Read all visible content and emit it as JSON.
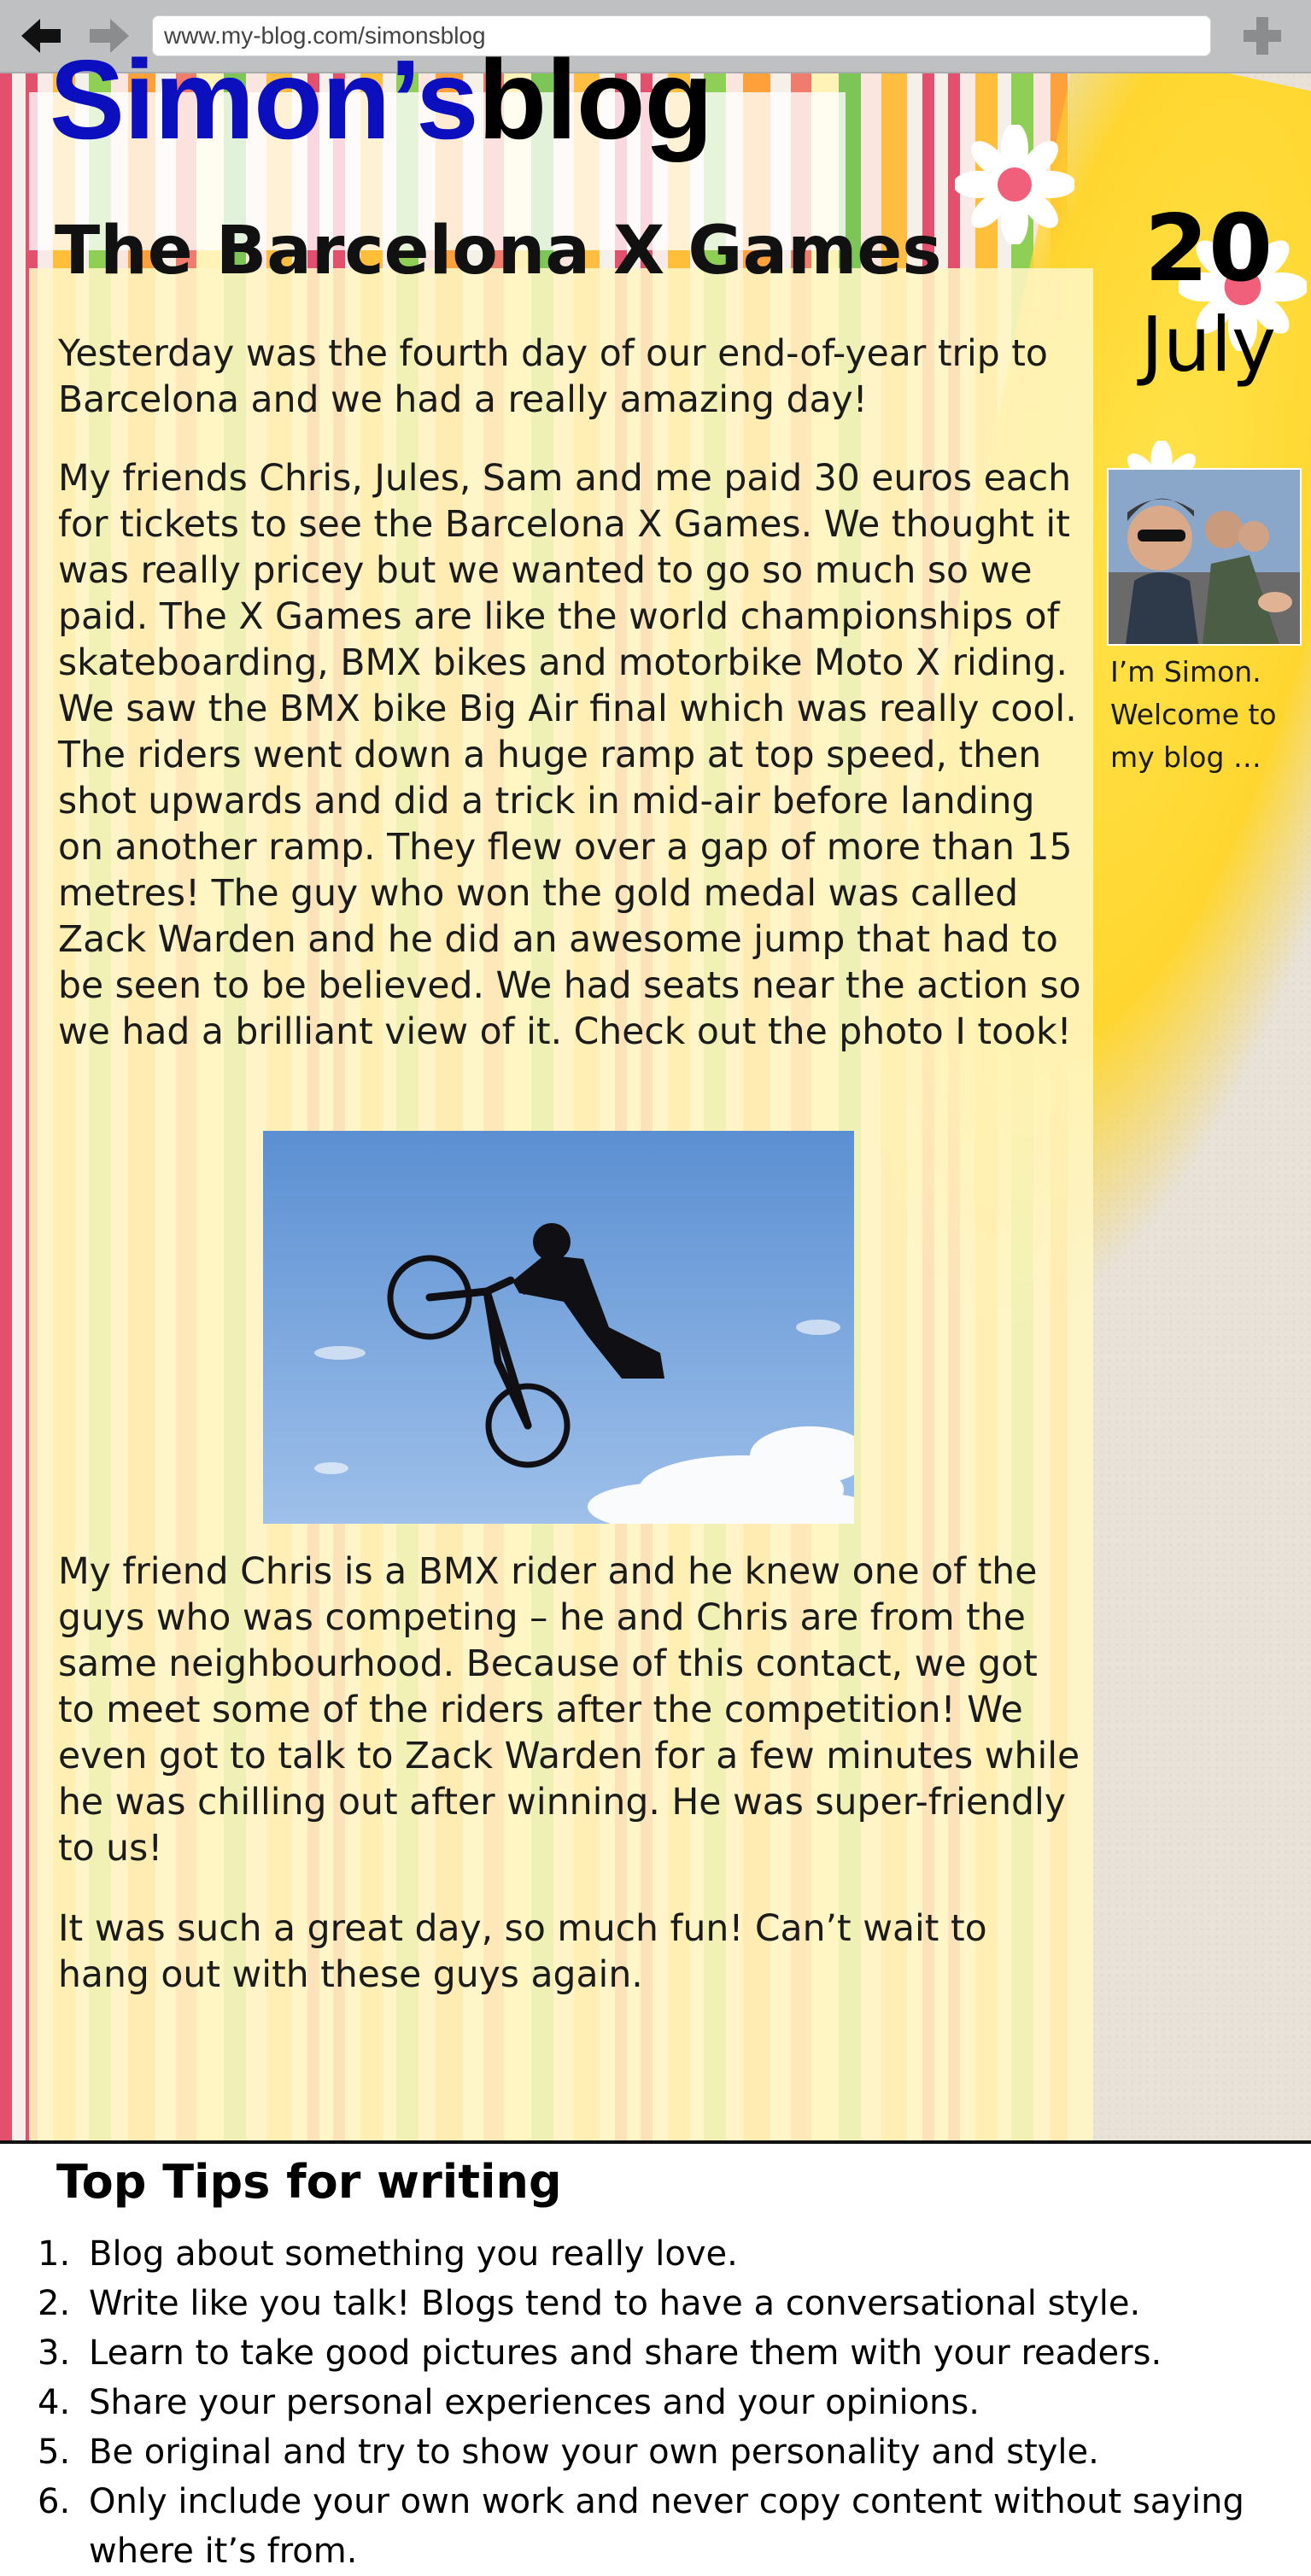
{
  "browser": {
    "url": "www.my-blog.com/simonsblog",
    "back_icon": "left-arrow-icon",
    "forward_icon": "right-arrow-icon",
    "new_tab_icon": "plus-icon"
  },
  "blog": {
    "title_part1": "Simon’s",
    "title_part2": "blog",
    "accent_color": "#0b0fbe"
  },
  "sidebar": {
    "date_day": "20",
    "date_month": "July",
    "bio": "I’m Simon. Welcome to my blog …"
  },
  "post": {
    "title": "The Barcelona X Games",
    "paragraphs": [
      "Yesterday was the fourth day of our end-of-year trip to Barcelona and we had a really amazing day!",
      "My friends Chris, Jules, Sam and me paid 30 euros each for tickets to see the Barcelona X Games. We thought it was really pricey but we wanted to go so much so we paid. The X Games are like the world championships of skateboarding, BMX bikes and motorbike Moto X riding. We saw the BMX bike Big Air final which was really cool. The riders went down a huge ramp at top speed, then shot upwards and did a trick in mid-air before landing on another ramp. They flew over a gap of more than 15 metres! The guy who won the gold medal was called Zack Warden and he did an awesome jump that had to be seen to be believed. We had seats near the action so we had a brilliant view of it. Check out the photo I took!",
      "My friend Chris is a BMX rider and he knew one of the guys who was competing – he and Chris are from the same neighbourhood. Because of this contact, we got to meet some of the riders after the competition! We even got to talk to Zack Warden for a few minutes while he was chilling out after winning. He was super-friendly to us!",
      "It was such a great day, so much fun! Can’t wait to hang out with these guys again."
    ]
  },
  "tips": {
    "title": "Top Tips for writing",
    "items": [
      {
        "num": "1.",
        "text": "Blog about something you really love."
      },
      {
        "num": "2.",
        "text": "Write like you talk! Blogs tend to have a conversational style."
      },
      {
        "num": "3.",
        "text": "Learn to take good pictures and share them with your readers."
      },
      {
        "num": "4.",
        "text": "Share your personal experiences and your opinions."
      },
      {
        "num": "5.",
        "text": "Be original and try to show your own personality and style."
      },
      {
        "num": "6.",
        "text": "Only include your own work and never copy content without saying where it’s from."
      }
    ]
  }
}
